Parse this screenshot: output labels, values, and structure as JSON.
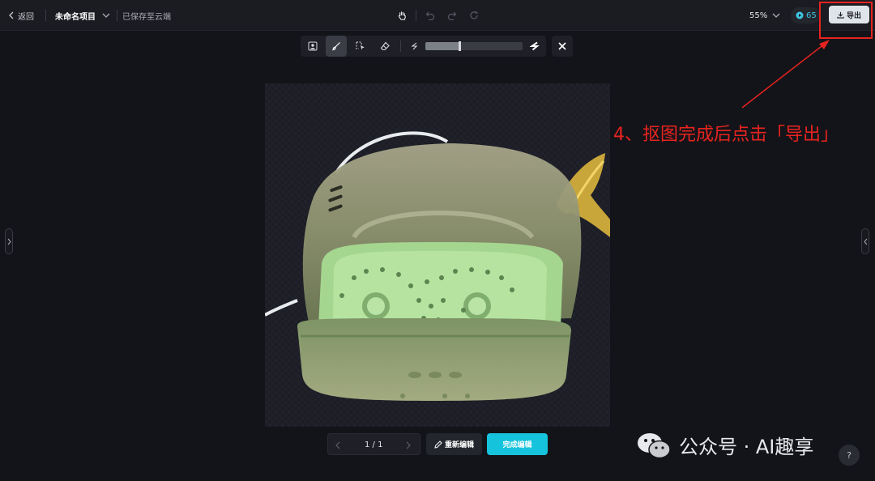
{
  "topbar": {
    "back_label": "返回",
    "project_name": "未命名项目",
    "saved_status": "已保存至云端",
    "zoom_label": "55%",
    "credits": "65",
    "export_label": "导出"
  },
  "toolbar": {
    "tools": [
      "person-select-icon",
      "brush-icon",
      "lasso-select-icon",
      "eraser-icon"
    ],
    "active_tool": "brush-icon",
    "brush_size_fraction": 0.35
  },
  "pager": {
    "page_indicator": "1 / 1"
  },
  "actions": {
    "reedit_label": "重新编辑",
    "finish_label": "完成编辑"
  },
  "annotation": {
    "text": "4、抠图完成后点击「导出」",
    "color": "#e8231f"
  },
  "watermark": {
    "text": "公众号 · AI趣享"
  },
  "help": {
    "label": "?"
  },
  "colors": {
    "accent": "#16c3dc",
    "background": "#131419",
    "annotation": "#e8231f"
  }
}
